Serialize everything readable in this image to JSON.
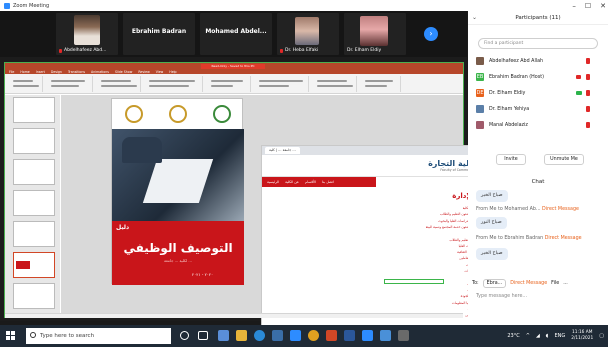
{
  "window": {
    "title": "Zoom Meeting",
    "controls": [
      "–",
      "☐",
      "✕"
    ]
  },
  "gallery": {
    "tiles": [
      {
        "name": "Abdelhafeez Abd...",
        "type": "video"
      },
      {
        "name": "Ebrahim Badran",
        "type": "name-only"
      },
      {
        "name": "Mohamed Abdel...",
        "type": "name-only"
      },
      {
        "name": "Dr. Heba Elfaki",
        "type": "video"
      },
      {
        "name": "Dr. Elham Eldiy",
        "type": "video"
      }
    ],
    "next_icon": "arrow-right-icon",
    "next_glyph": "›"
  },
  "share": {
    "title_badge": "Read-Only - Saved to this PC",
    "menu_items": [
      "File",
      "Home",
      "Insert",
      "Design",
      "Transitions",
      "Animations",
      "Slide Show",
      "Review",
      "View",
      "Help"
    ],
    "slide_count_label": "⊕",
    "cover": {
      "small_title": "دليل",
      "main_title": "التوصيف الوظيفي",
      "subtitle": "لكلية ... جامعة ...",
      "year": "٢٠٢٠ - ٢٠٢١"
    }
  },
  "browser": {
    "tab": "جامعة ...  |  كلية ...",
    "controls": [
      "–",
      "☐",
      "✕"
    ],
    "site_name": "كلية التجارة",
    "site_sub": "Faculty of Commerce",
    "nav_items": [
      "الرئيسية",
      "عن الكلية",
      "الأقسام",
      "اتصل بنا"
    ],
    "section_icon": "≡",
    "section_title": "الإدارة",
    "toc": [
      "مكتب عميد الكلية",
      "وكيل الكلية لشئون التعليم والطلاب",
      "وكيل الكلية للدراسات العليا والبحوث",
      "وكيل الكلية لشئون خدمة المجتمع وتنمية البيئة",
      "أمين الكلية",
      "إدارة شئون التعليم والطلاب",
      "إدارة الدراسات العليا",
      "إدارة العلاقات الثقافية",
      "إدارة شئون العاملين",
      "إدارة الحسابات",
      "إدارة المشتريات",
      "إدارة المخازن",
      "إدارة المكتبات",
      "إدارة الخدمات",
      "وحدة ضمان الجودة",
      "وحدة تكنولوجيا المعلومات",
      "مكتب المتابعة",
      "شئون الخريجين",
      "رعاية الطلاب",
      "إدارة الأمن"
    ]
  },
  "panel": {
    "header": "Participants (11)",
    "search_placeholder": "Find a participant",
    "participants": [
      {
        "name": "Abdelhafeez Abd Allah",
        "initial": "",
        "color": "#7a5c4a",
        "mic": "off",
        "video": "none"
      },
      {
        "name": "Ebrahim Badran (Host)",
        "initial": "EB",
        "color": "#3bb54a",
        "mic": "off",
        "video": "off"
      },
      {
        "name": "Dr. Elham Eldiy",
        "initial": "DE",
        "color": "#e8621c",
        "mic": "off",
        "video": "on"
      },
      {
        "name": "Dr. Elham Yehiya",
        "initial": "",
        "color": "#5b7fa8",
        "mic": "off",
        "video": "none"
      },
      {
        "name": "Manal Abdelaziz",
        "initial": "",
        "color": "#a05a6a",
        "mic": "off",
        "video": "none"
      }
    ],
    "invite_label": "Invite",
    "unmute_label": "Unmute Me",
    "chat_title": "Chat",
    "messages": [
      {
        "from": "",
        "to": "",
        "text": "صباح الخير"
      },
      {
        "from": "From Me to Mohamed Ab...",
        "to": "Direct Message",
        "text": "صباح النور"
      },
      {
        "from": "From Me to Ebrahim Badran",
        "to": "Direct Message",
        "text": "صباح الخير"
      }
    ],
    "to_label": "To:",
    "to_value": "Ebra...",
    "to_direct": "Direct Message",
    "file_label": "File",
    "more": "...",
    "input_placeholder": "Type message here..."
  },
  "taskbar": {
    "search_placeholder": "Type here to search",
    "tray_temp": "23°C",
    "tray_lang": "ENG",
    "time": "11:16 AM",
    "date": "2/11/2021"
  }
}
